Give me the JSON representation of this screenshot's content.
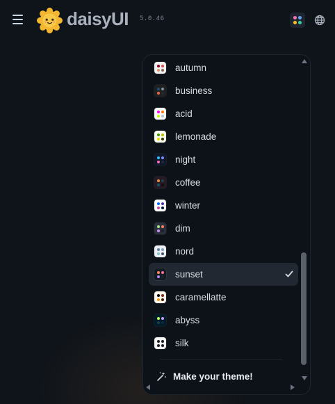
{
  "header": {
    "brand": "daisyUI",
    "version": "5.0.46",
    "menu_icon": "hamburger-icon",
    "theme_icon": "palette-icon",
    "language_icon": "globe-icon",
    "theme_button_colors": [
      "#f472b6",
      "#60a5fa",
      "#fbbf24",
      "#34d399"
    ]
  },
  "theme_menu": {
    "selected": "sunset",
    "check_icon": "check-icon",
    "items": [
      {
        "name": "autumn",
        "bg": "#f1f1f1",
        "dots": [
          "#8c0327",
          "#d85251",
          "#d59b6a",
          "#826a5c"
        ]
      },
      {
        "name": "business",
        "bg": "#202020",
        "dots": [
          "#1c4e80",
          "#7c909a",
          "#ea6947",
          "#23282e"
        ]
      },
      {
        "name": "acid",
        "bg": "#fafafa",
        "dots": [
          "#ff00f4",
          "#ff7400",
          "#cbfd03",
          "#b8c4ce"
        ]
      },
      {
        "name": "lemonade",
        "bg": "#f8fdef",
        "dots": [
          "#419400",
          "#bbbd00",
          "#ebd700",
          "#3a3700"
        ]
      },
      {
        "name": "night",
        "bg": "#0f172a",
        "dots": [
          "#38bdf8",
          "#818cf8",
          "#f471b5",
          "#1e293b"
        ]
      },
      {
        "name": "coffee",
        "bg": "#261b25",
        "dots": [
          "#db924b",
          "#263e3f",
          "#10576d",
          "#120c12"
        ]
      },
      {
        "name": "winter",
        "bg": "#ffffff",
        "dots": [
          "#0069ff",
          "#463aa1",
          "#c149ad",
          "#021431"
        ]
      },
      {
        "name": "dim",
        "bg": "#2a303c",
        "dots": [
          "#9fe88d",
          "#ff7d5c",
          "#c792e9",
          "#1c212b"
        ]
      },
      {
        "name": "nord",
        "bg": "#eceff4",
        "dots": [
          "#5e81ac",
          "#81a1c1",
          "#88c0d0",
          "#4c566a"
        ]
      },
      {
        "name": "sunset",
        "bg": "#121c22",
        "dots": [
          "#ff865b",
          "#fd6f9c",
          "#b387fa",
          "#1b262c"
        ]
      },
      {
        "name": "caramellatte",
        "bg": "#fff7ed",
        "dots": [
          "#000000",
          "#7c2d12",
          "#f59e0b",
          "#451a03"
        ]
      },
      {
        "name": "abyss",
        "bg": "#001b29",
        "dots": [
          "#c0ff5e",
          "#c6a0f6",
          "#1f3d50",
          "#0d2a3b"
        ]
      },
      {
        "name": "silk",
        "bg": "#f7f5f3",
        "dots": [
          "#1c1c29",
          "#1c1c29",
          "#1c1c29",
          "#1c1c29"
        ]
      }
    ],
    "make_theme_label": "Make your theme!",
    "make_theme_icon": "magic-wand-icon"
  }
}
